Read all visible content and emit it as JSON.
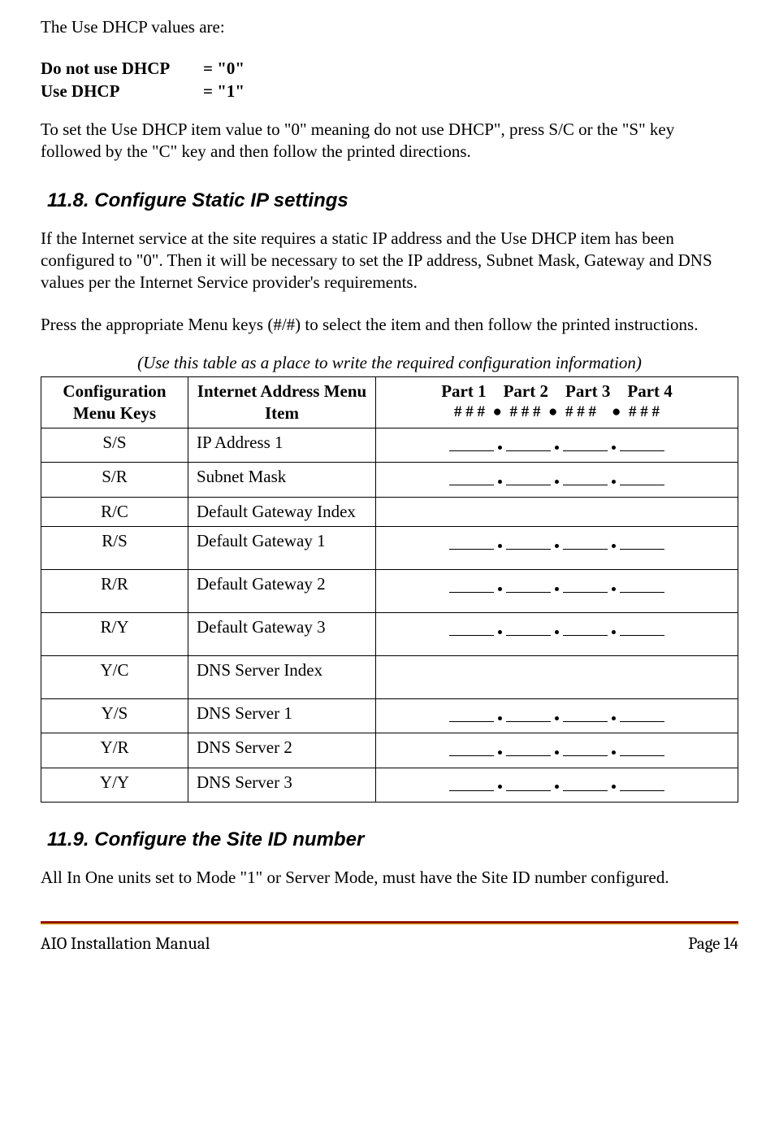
{
  "intro": "The Use DHCP values are:",
  "dhcp_rows": [
    {
      "label": "Do not use DHCP",
      "value": "= \"0\""
    },
    {
      "label": "Use DHCP",
      "value": "= \"1\""
    }
  ],
  "dhcp_instruction": "To set the Use DHCP item value to \"0\" meaning do not use DHCP\", press S/C or the \"S\" key followed by the \"C\" key and then follow the printed directions.",
  "section_11_8": {
    "heading": "11.8. Configure Static IP settings",
    "para1": "If the Internet service at the site requires a static IP address and the Use DHCP item has been configured to \"0\".  Then it will be necessary to set the IP address, Subnet Mask, Gateway and DNS values per the Internet Service provider's requirements.",
    "para2": "Press the appropriate Menu keys (#/#) to select the item and then follow the printed instructions.",
    "table_caption": "(Use this table as a place to write the required configuration information)",
    "headers": {
      "col1": "Configuration Menu Keys",
      "col2": "Internet Address Menu Item",
      "col3_line1": "Part 1 Part 2 Part 3 Part 4",
      "col3_line2": "# # # ● # # # ● # # # ● # # #"
    },
    "rows": [
      {
        "keys": "S/S",
        "item": "IP Address 1",
        "has_ip": true
      },
      {
        "keys": "S/R",
        "item": "Subnet Mask",
        "has_ip": true
      },
      {
        "keys": "R/C",
        "item": "Default Gateway Index",
        "has_ip": false
      },
      {
        "keys": "R/S",
        "item": "Default Gateway 1",
        "has_ip": true
      },
      {
        "keys": "R/R",
        "item": "Default Gateway 2",
        "has_ip": true
      },
      {
        "keys": "R/Y",
        "item": "Default Gateway 3",
        "has_ip": true
      },
      {
        "keys": "Y/C",
        "item": "DNS Server Index",
        "has_ip": false
      },
      {
        "keys": "Y/S",
        "item": "DNS Server 1",
        "has_ip": true
      },
      {
        "keys": "Y/R",
        "item": "DNS Server 2",
        "has_ip": true
      },
      {
        "keys": "Y/Y",
        "item": "DNS Server 3",
        "has_ip": true
      }
    ]
  },
  "section_11_9": {
    "heading": "11.9. Configure the Site ID number",
    "para1": "All In One units set to Mode \"1\" or Server Mode, must have the Site ID number configured."
  },
  "footer": {
    "left": "AIO Installation Manual",
    "right": "Page 14"
  }
}
